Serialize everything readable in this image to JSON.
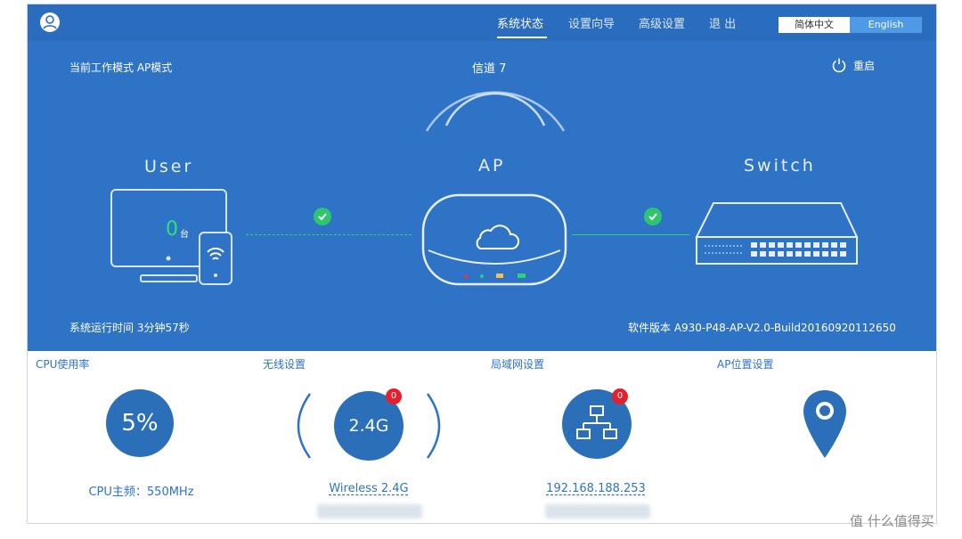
{
  "nav": {
    "items": [
      "系统状态",
      "设置向导",
      "高级设置",
      "退 出"
    ],
    "lang_cn": "简体中文",
    "lang_en": "English"
  },
  "status": {
    "work_mode": "当前工作模式  AP模式",
    "channel": "信道 7",
    "reboot": "重启",
    "uptime": "系统运行时间  3分钟57秒",
    "firmware": "软件版本  A930-P48-AP-V2.0-Build20160920112650"
  },
  "devices": {
    "user_title": "User",
    "ap_title": "AP",
    "switch_title": "Switch",
    "user_count": "0",
    "user_count_unit": "台"
  },
  "panels": {
    "cpu": {
      "title": "CPU使用率",
      "value": "5%",
      "footer": "CPU主频：550MHz"
    },
    "wireless": {
      "title": "无线设置",
      "value": "2.4G",
      "badge": "0",
      "footer": "Wireless 2.4G"
    },
    "lan": {
      "title": "局域网设置",
      "badge": "0",
      "footer": "192.168.188.253"
    },
    "ap_location": {
      "title": "AP位置设置"
    }
  },
  "watermark": "值 什么值得买",
  "colors": {
    "primary": "#2e73c5",
    "link": "#2fd07a",
    "badge": "#e5202d"
  }
}
